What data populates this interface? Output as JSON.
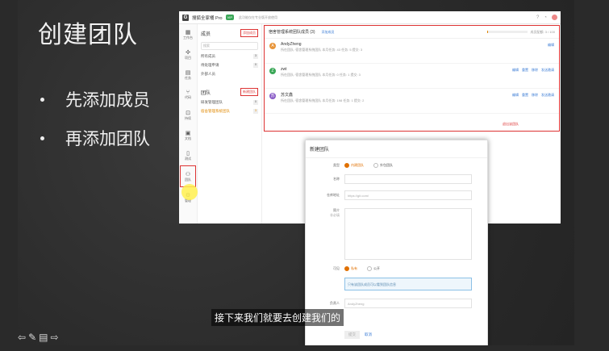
{
  "slide": {
    "title": "创建团队",
    "bullets": [
      "先添加成员",
      "再添加团队"
    ],
    "subtitle": "接下来我们就要去创建我们的"
  },
  "app": {
    "name": "搜狐全家桶 Pro",
    "vip": "VIP",
    "notice": "此功能仅在专业版开放使用",
    "icon_bar": [
      {
        "glyph": "▦",
        "label": "工作台"
      },
      {
        "glyph": "✣",
        "label": "项目"
      },
      {
        "glyph": "▤",
        "label": "任务"
      },
      {
        "glyph": "⑂",
        "label": "代码"
      },
      {
        "glyph": "⊡",
        "label": "持续"
      },
      {
        "glyph": "▣",
        "label": "文档"
      },
      {
        "glyph": "▯",
        "label": "测试"
      },
      {
        "glyph": "⚇",
        "label": "团队"
      },
      {
        "glyph": "⚙",
        "label": "管理"
      }
    ],
    "sidebar": {
      "members_title": "成员",
      "add_member": "添加成员",
      "search_placeholder": "搜索",
      "member_items": [
        {
          "label": "所有成员",
          "count": "3"
        },
        {
          "label": "待处理申请",
          "count": "0"
        },
        {
          "label": "外部人员",
          "count": ""
        }
      ],
      "team_title": "团队",
      "add_team": "新建团队",
      "team_items": [
        {
          "label": "研发管理团队",
          "count": "0"
        },
        {
          "label": "宿舍管理系统团队",
          "count": "3"
        }
      ]
    },
    "team_panel": {
      "title": "宿舍管理系统团队成员 (3)",
      "add_link": "添加成员",
      "progress_text": "成员配额: 3 / 100",
      "progress": 0.03,
      "members": [
        {
          "avatar": "A",
          "color": "#e8953a",
          "name": "AndyZheng",
          "detail": "所在团队: 宿舍管理系统团队   本月任务: 43   任务: 5   提交: 3",
          "actions": [
            "编辑"
          ]
        },
        {
          "avatar": "Z",
          "color": "#3aa757",
          "name": "zwt",
          "detail": "所在团队: 宿舍管理系统团队   本月任务: 0   任务: 1   提交: 3",
          "actions": [
            "编辑",
            "重置",
            "移除",
            "发送邀请"
          ]
        },
        {
          "avatar": "苏",
          "color": "#8a5cc7",
          "name": "苏文鑫",
          "detail": "所在团队: 宿舍管理系统团队   本月任务: 198   任务: 1   提交: 2",
          "actions": [
            "编辑",
            "重置",
            "移除",
            "发送邀请"
          ]
        }
      ],
      "footer_link": "退出该团队"
    }
  },
  "modal": {
    "title": "新建团队",
    "type_label": "类型",
    "type_options": [
      "内建团队",
      "外包团队"
    ],
    "name_label": "名称",
    "url_label": "仓库地址",
    "url_placeholder": "https://git.com/",
    "desc_label": "简介",
    "desc_sub": "非必填",
    "visibility_label": "可见",
    "visibility_options": [
      "私有",
      "公开"
    ],
    "visibility_tip": "只有该团队成员可以看到团队信息",
    "owner_label": "负责人",
    "owner_value": "AndyZheng",
    "submit": "提交",
    "cancel": "取消"
  },
  "toolbar_icons": [
    "prev-icon",
    "pen-icon",
    "menu-icon",
    "next-icon"
  ]
}
